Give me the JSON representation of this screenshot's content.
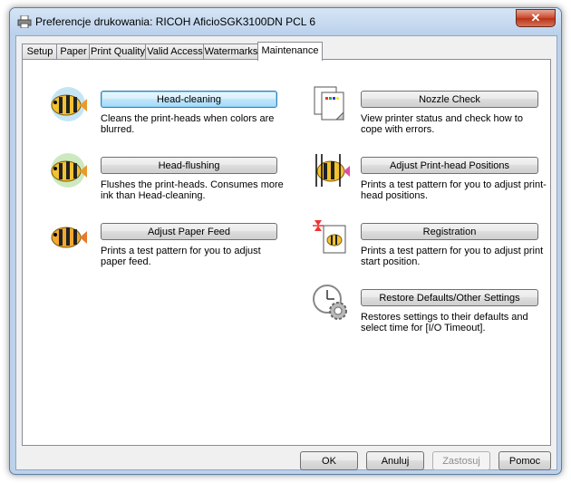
{
  "window": {
    "title": "Preferencje drukowania: RICOH AficioSGK3100DN PCL 6",
    "close_label": "✕"
  },
  "tabs": [
    {
      "label": "Setup"
    },
    {
      "label": "Paper"
    },
    {
      "label": "Print Quality"
    },
    {
      "label": "Valid Access"
    },
    {
      "label": "Watermarks"
    },
    {
      "label": "Maintenance",
      "active": true
    }
  ],
  "maintenance": {
    "head_cleaning": {
      "label": "Head-cleaning",
      "desc": "Cleans the print-heads when colors are blurred."
    },
    "head_flushing": {
      "label": "Head-flushing",
      "desc": "Flushes the print-heads. Consumes more ink than Head-cleaning."
    },
    "adjust_paper_feed": {
      "label": "Adjust Paper Feed",
      "desc": "Prints a test pattern for you to adjust paper feed."
    },
    "nozzle_check": {
      "label": "Nozzle Check",
      "desc": "View printer status and check how to cope with errors."
    },
    "adjust_print_head": {
      "label": "Adjust Print-head Positions",
      "desc": "Prints a test pattern for you to adjust print-head positions."
    },
    "registration": {
      "label": "Registration",
      "desc": "Prints a test pattern for you to adjust print start position."
    },
    "restore_defaults": {
      "label": "Restore Defaults/Other Settings",
      "desc": "Restores settings to their defaults and select time for [I/O Timeout]."
    }
  },
  "footer": {
    "ok": "OK",
    "cancel": "Anuluj",
    "apply": "Zastosuj",
    "help": "Pomoc"
  }
}
